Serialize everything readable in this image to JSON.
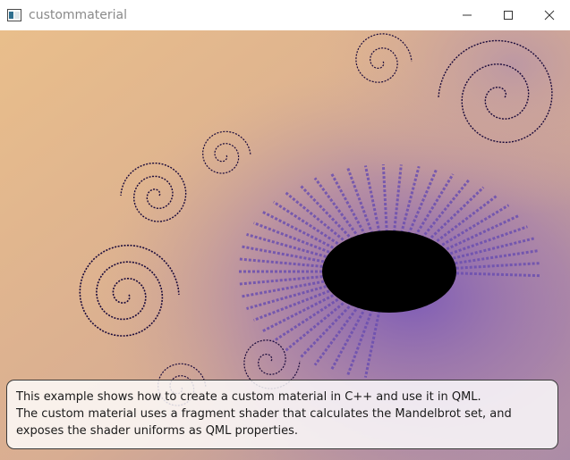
{
  "window": {
    "title": "custommaterial",
    "app_icon": "qt-window-icon",
    "controls": [
      "minimize-icon",
      "maximize-icon",
      "close-icon"
    ]
  },
  "canvas": {
    "content": "mandelbrot-fractal-render",
    "colors": {
      "background_light": "#e8bd8c",
      "background_purple": "#b08aa6",
      "fractal_dark": "#1a0a3a",
      "fractal_purple": "#6b4fb0",
      "set_interior": "#000000"
    }
  },
  "description": {
    "line1": "This example shows how to create a custom material in C++ and use it in QML.",
    "line2": "The custom material uses a fragment shader that calculates the Mandelbrot set, and",
    "line3": "exposes the shader uniforms as QML properties."
  }
}
